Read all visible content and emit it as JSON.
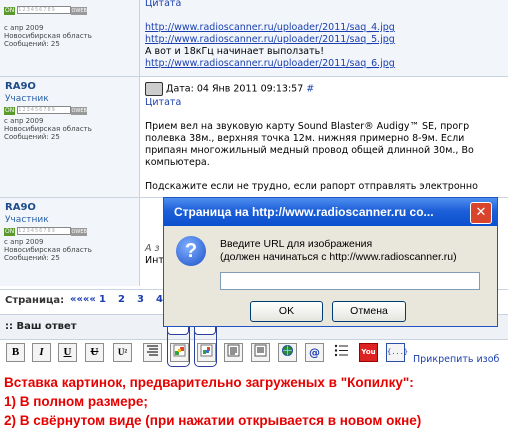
{
  "posts": [
    {
      "meta": [
        "с апр 2009",
        "Новосибирская область",
        "Сообщений: 25"
      ],
      "lines": [
        {
          "text": "Цитата",
          "type": "quote"
        },
        {
          "text": "",
          "type": "text"
        },
        {
          "text": "http://www.radioscanner.ru/uploader/2011/saq_4.jpg",
          "type": "link"
        },
        {
          "text": "http://www.radioscanner.ru/uploader/2011/saq_5.jpg",
          "type": "link"
        },
        {
          "text": "А вот и 18кГц начинает выползать!",
          "type": "text"
        },
        {
          "text": "http://www.radioscanner.ru/uploader/2011/saq_6.jpg",
          "type": "link"
        }
      ]
    },
    {
      "username": "RA9O",
      "role": "Участник",
      "meta": [
        "с апр 2009",
        "Новосибирская область",
        "Сообщений: 25"
      ],
      "date": "Дата: 04 Янв 2011 09:13:57",
      "anchor": "#",
      "lines": [
        {
          "text": "Цитата",
          "type": "quote"
        },
        {
          "text": "",
          "type": "text"
        },
        {
          "text": "Прием вел на звуковую карту Sound Blaster® Audigy™ SE, прогр",
          "type": "text"
        },
        {
          "text": "полевка 38м., верхняя точка 12м. нижняя примерно 8-9м. Если",
          "type": "text"
        },
        {
          "text": "припаян многожильный медный провод общей длинной 30м., Во",
          "type": "text"
        },
        {
          "text": "компьютера.",
          "type": "text"
        },
        {
          "text": "",
          "type": "text"
        },
        {
          "text": "Подскажите если не трудно, если рапорт отправлять электронно",
          "type": "text"
        }
      ]
    },
    {
      "username": "RA9O",
      "role": "Участник",
      "meta": [
        "с апр 2009",
        "Новосибирская область",
        "Сообщений: 25"
      ],
      "lines": [
        {
          "text": "А з",
          "type": "italic"
        },
        {
          "text": "Инт",
          "type": "text"
        }
      ]
    }
  ],
  "status": {
    "on": "ON",
    "bar": "123456789",
    "user": "OWEB"
  },
  "pagination": {
    "label": "Страница:",
    "first": "««««",
    "pages": [
      "1",
      "2",
      "3",
      "4"
    ]
  },
  "reply": {
    "title": ":: Ваш ответ"
  },
  "toolbar": {
    "bold": "B",
    "italic": "I",
    "underline": "U",
    "strike": "U",
    "superscript": "U²",
    "at": "@",
    "youtube": "You",
    "code": "{...}",
    "attach": "Прикрепить изоб"
  },
  "dialog": {
    "title": "Страница на http://www.radioscanner.ru со...",
    "close": "✕",
    "icon": "?",
    "line1": "Введите URL для изображения",
    "line2": "(должен начинаться с http://www.radioscanner.ru)",
    "input_value": "",
    "ok": "OK",
    "cancel": "Отмена"
  },
  "markers": {
    "one": "1.",
    "two": "2."
  },
  "caption": {
    "line1": "Вставка картинок, предварительно загруженых в \"Копилку\":",
    "line2": "1) В полном размере;",
    "line3": "2) В свёрнутом виде (при нажатии открывается в новом окне)"
  },
  "colors": {
    "accent": "#1b3fb0",
    "dialog_title": "#1d5fd8",
    "caption": "#e60000"
  }
}
